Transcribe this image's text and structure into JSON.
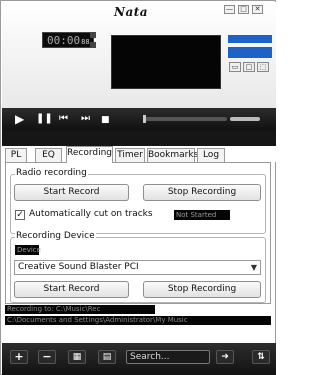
{
  "app": {
    "logo": "Nata",
    "window_buttons": [
      "—",
      "□",
      "✕"
    ]
  },
  "player": {
    "time_display": "00:00",
    "time_suffix": "88",
    "transport": {
      "play_icon": "play-icon",
      "pause_icon": "pause-icon",
      "prev_icon": "previous-icon",
      "next_icon": "next-icon",
      "stop_icon": "stop-icon"
    },
    "side_buttons": [
      "▭",
      "□",
      "⬚"
    ]
  },
  "tabs": [
    "PL",
    "EQ",
    "Recording",
    "Timer",
    "Bookmarks",
    "Log"
  ],
  "active_tab": "Recording",
  "recording": {
    "radio_group_label": "Radio recording",
    "radio_start_label": "Start Record",
    "radio_stop_label": "Stop Recording",
    "auto_cut_label": "Automatically cut on tracks",
    "auto_cut_checked": true,
    "radio_status_tag": "Not Started",
    "device_group_label": "Recording Device",
    "device_small_tag": "Device",
    "device_selected": "Creative Sound Blaster PCI",
    "device_start_label": "Start Record",
    "device_stop_label": "Stop Recording",
    "output_line_1": "Recording to: C:\\Music\\Rec",
    "output_line_2": "C:\\Documents and Settings\\Administrator\\My Music"
  },
  "bottom_bar": {
    "add_label": "+",
    "remove_label": "−",
    "search_placeholder": "Search...",
    "colors": {
      "accent": "#1c62c7",
      "dark": "#121212"
    }
  }
}
